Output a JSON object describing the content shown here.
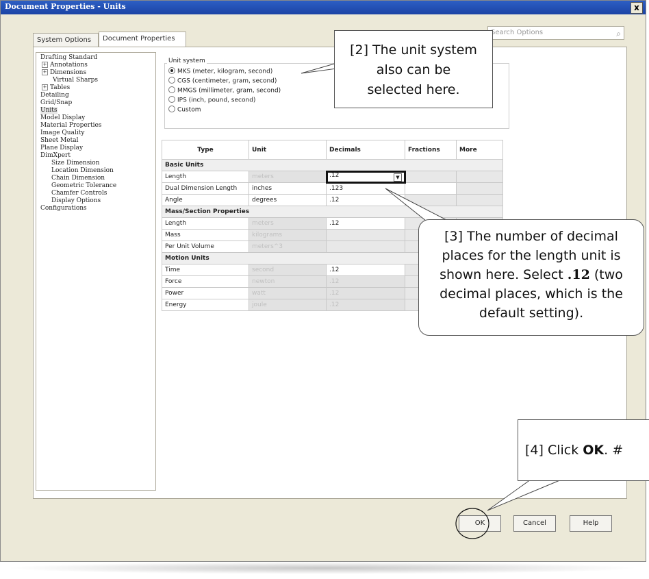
{
  "window": {
    "title": "Document Properties - Units",
    "close": "x"
  },
  "tabs": [
    "System Options",
    "Document Properties"
  ],
  "search": {
    "placeholder": "Search Options"
  },
  "tree": {
    "items": [
      "Drafting Standard",
      "Annotations",
      "Dimensions",
      "Virtual Sharps",
      "Tables",
      "Detailing",
      "Grid/Snap",
      "Units",
      "Model Display",
      "Material Properties",
      "Image Quality",
      "Sheet Metal",
      "Plane Display",
      "DimXpert",
      "Size Dimension",
      "Location Dimension",
      "Chain Dimension",
      "Geometric Tolerance",
      "Chamfer Controls",
      "Display Options",
      "Configurations"
    ]
  },
  "unit_system": {
    "label": "Unit system",
    "options": [
      "MKS (meter, kilogram, second)",
      "CGS (centimeter, gram, second)",
      "MMGS (millimeter, gram, second)",
      "IPS (inch, pound, second)",
      "Custom"
    ],
    "selected": "MKS (meter, kilogram, second)"
  },
  "table": {
    "headers": [
      "Type",
      "Unit",
      "Decimals",
      "Fractions",
      "More"
    ],
    "sections": [
      {
        "title": "Basic Units",
        "rows": [
          {
            "type": "Length",
            "unit": "meters",
            "decimals": ".12"
          },
          {
            "type": "Dual Dimension Length",
            "unit": "inches",
            "decimals": ".123"
          },
          {
            "type": "Angle",
            "unit": "degrees",
            "decimals": ".12"
          }
        ]
      },
      {
        "title": "Mass/Section Properties",
        "rows": [
          {
            "type": "Length",
            "unit": "meters",
            "decimals": ".12"
          },
          {
            "type": "Mass",
            "unit": "kilograms",
            "decimals": ""
          },
          {
            "type": "Per Unit Volume",
            "unit": "meters^3",
            "decimals": ""
          }
        ]
      },
      {
        "title": "Motion Units",
        "rows": [
          {
            "type": "Time",
            "unit": "second",
            "decimals": ".12"
          },
          {
            "type": "Force",
            "unit": "newton",
            "decimals": ".12"
          },
          {
            "type": "Power",
            "unit": "watt",
            "decimals": ".12"
          },
          {
            "type": "Energy",
            "unit": "joule",
            "decimals": ".12"
          }
        ]
      }
    ]
  },
  "callouts": {
    "c2": [
      "[2] The unit system",
      "also can be",
      "selected here."
    ],
    "c3": {
      "prefix": "[3] The number of decimal places for the length unit is shown here.  Select ",
      "bold": ".12",
      "suffix": " (two decimal places, which is the default setting)."
    },
    "c4": {
      "prefix": "[4] Click ",
      "bold": "OK",
      "suffix": ". #"
    }
  },
  "buttons": {
    "ok": "OK",
    "cancel": "Cancel",
    "help": "Help"
  }
}
